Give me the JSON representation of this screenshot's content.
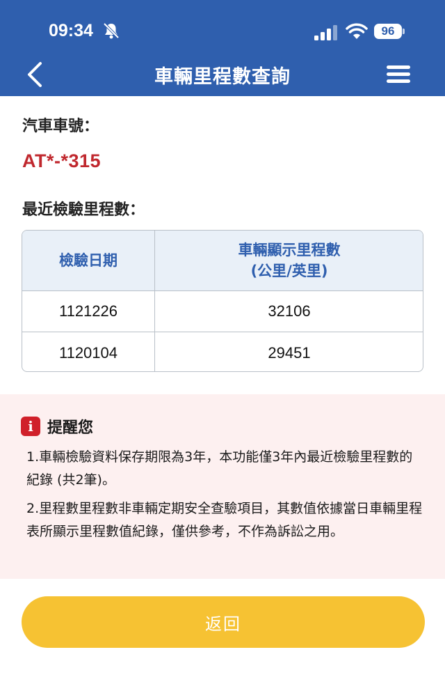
{
  "status_bar": {
    "time": "09:34",
    "battery": "96",
    "icons": [
      "bell-slash-icon",
      "signal-icon",
      "wifi-icon",
      "battery-icon"
    ]
  },
  "header": {
    "title": "車輛里程數查詢",
    "back_icon": "chevron-left-icon",
    "menu_icon": "hamburger-menu-icon",
    "bg_color": "#2f5fae"
  },
  "vehicle": {
    "plate_label": "汽車車號：",
    "plate_value": "AT*-*315",
    "plate_color": "#c0282e"
  },
  "mileage": {
    "section_label": "最近檢驗里程數：",
    "columns": [
      "檢驗日期",
      "車輛顯示里程數",
      "(公里/英里)"
    ],
    "rows": [
      {
        "date": "1121226",
        "mileage": "32106"
      },
      {
        "date": "1120104",
        "mileage": "29451"
      }
    ]
  },
  "notice": {
    "title": "提醒您",
    "icon": "info-icon",
    "items": [
      "1.車輛檢驗資料保存期限為3年，本功能僅3年內最近檢驗里程數的紀錄 (共2筆)。",
      "2.里程數里程數非車輛定期安全查驗項目，其數值依據當日車輛里程表所顯示里程數值紀錄，僅供參考，不作為訴訟之用。"
    ]
  },
  "footer": {
    "back_label": "返回",
    "button_color": "#f6c233"
  }
}
